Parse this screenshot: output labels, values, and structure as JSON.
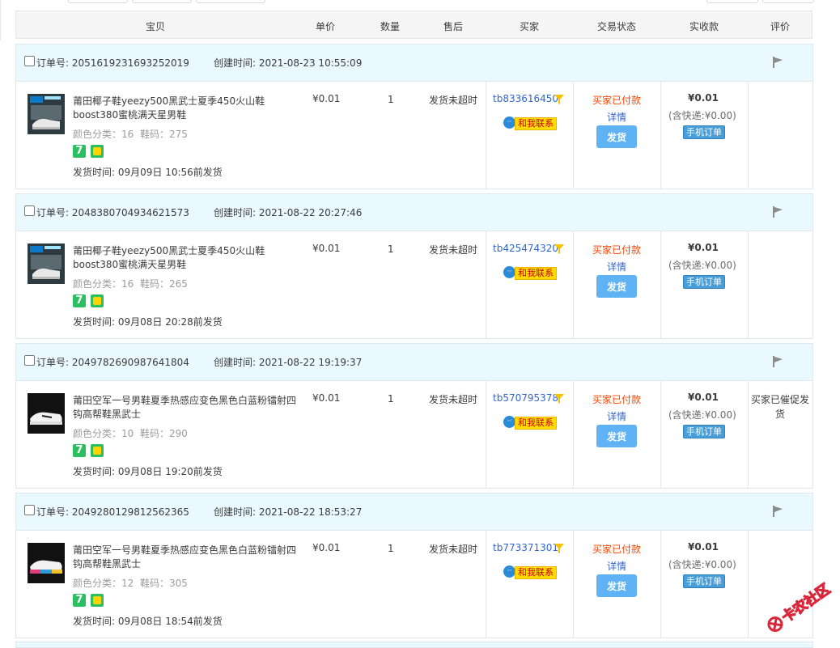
{
  "header": {
    "columns": [
      "宝贝",
      "单价",
      "数量",
      "售后",
      "买家",
      "交易状态",
      "实收款",
      "评价"
    ]
  },
  "labels": {
    "order_no": "订单号:",
    "created": "创建时间:",
    "color": "颜色分类",
    "size": "鞋码",
    "ship_time_prefix": "发货时间:",
    "contact": "和我联系",
    "detail": "详情",
    "send": "发货",
    "mobile_order": "手机订单",
    "seven_days": "7"
  },
  "orders": [
    {
      "order_no": "2051619231693252019",
      "created": "2021-08-23 10:55:09",
      "title": "莆田椰子鞋yeezy500黑武士夏季450火山鞋boost380蜜桃满天星男鞋",
      "color": "16",
      "size": "275",
      "ship_time": "09月09日 10:56前发货",
      "price": "¥0.01",
      "qty": "1",
      "after_sale": "发货未超时",
      "buyer": "tb833616450",
      "status": "买家已付款",
      "amount": "¥0.01",
      "fee": "(含快递:¥0.00)",
      "review": "",
      "thumb": "box"
    },
    {
      "order_no": "2048380704934621573",
      "created": "2021-08-22 20:27:46",
      "title": "莆田椰子鞋yeezy500黑武士夏季450火山鞋boost380蜜桃满天星男鞋",
      "color": "16",
      "size": "265",
      "ship_time": "09月08日 20:28前发货",
      "price": "¥0.01",
      "qty": "1",
      "after_sale": "发货未超时",
      "buyer": "tb425474320",
      "status": "买家已付款",
      "amount": "¥0.01",
      "fee": "(含快递:¥0.00)",
      "review": "",
      "thumb": "box"
    },
    {
      "order_no": "2049782690987641804",
      "created": "2021-08-22 19:19:37",
      "title": "莆田空军一号男鞋夏季热感应变色黑色白蓝粉镭射四钩高帮鞋黑武士",
      "color": "10",
      "size": "290",
      "ship_time": "09月08日 19:20前发货",
      "price": "¥0.01",
      "qty": "1",
      "after_sale": "发货未超时",
      "buyer": "tb570795378",
      "status": "买家已付款",
      "amount": "¥0.01",
      "fee": "(含快递:¥0.00)",
      "review": "买家已催促发货",
      "thumb": "shoe"
    },
    {
      "order_no": "2049280129812562365",
      "created": "2021-08-22 18:53:27",
      "title": "莆田空军一号男鞋夏季热感应变色黑色白蓝粉镭射四钩高帮鞋黑武士",
      "color": "12",
      "size": "305",
      "ship_time": "09月08日 18:54前发货",
      "price": "¥0.01",
      "qty": "1",
      "after_sale": "发货未超时",
      "buyer": "tb773371301",
      "status": "买家已付款",
      "amount": "¥0.01",
      "fee": "(含快递:¥0.00)",
      "review": "",
      "thumb": "shoe-rainbow"
    }
  ],
  "watermark": "卡农社区"
}
